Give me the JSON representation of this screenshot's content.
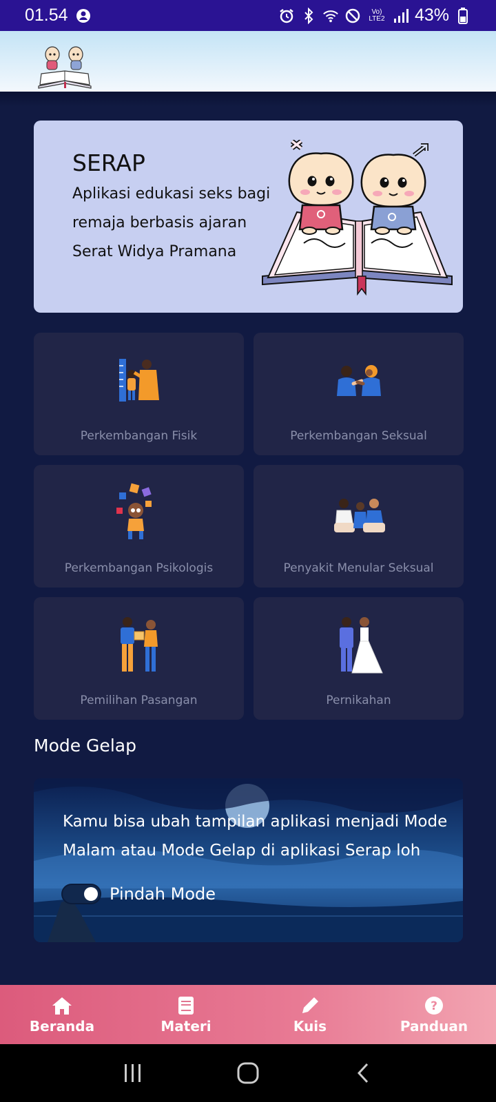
{
  "status": {
    "time": "01.54",
    "battery": "43%",
    "icons": [
      "profile-icon",
      "alarm-icon",
      "bluetooth-icon",
      "wifi-icon",
      "dnd-icon",
      "lte-icon",
      "signal-icon",
      "battery-icon"
    ],
    "lte_label": "Vo) LTE2"
  },
  "hero": {
    "title": "SERAP",
    "description": "Aplikasi edukasi seks bagi remaja berbasis ajaran Serat Widya Pramana"
  },
  "menu": [
    {
      "label": "Perkembangan Fisik",
      "icon": "height-measure-icon"
    },
    {
      "label": "Perkembangan Seksual",
      "icon": "couple-handshake-icon"
    },
    {
      "label": "Perkembangan Psikologis",
      "icon": "puzzle-thinking-icon"
    },
    {
      "label": "Penyakit Menular Seksual",
      "icon": "doctor-consult-icon"
    },
    {
      "label": "Pemilihan Pasangan",
      "icon": "gift-exchange-icon"
    },
    {
      "label": "Pernikahan",
      "icon": "wedding-couple-icon"
    }
  ],
  "dark_mode": {
    "section_title": "Mode Gelap",
    "text": "Kamu bisa ubah tampilan aplikasi menjadi Mode Malam atau Mode Gelap di aplikasi Serap loh",
    "toggle_label": "Pindah Mode",
    "toggle_on": true
  },
  "nav": [
    {
      "label": "Beranda",
      "icon": "home-icon"
    },
    {
      "label": "Materi",
      "icon": "book-icon"
    },
    {
      "label": "Kuis",
      "icon": "pencil-icon"
    },
    {
      "label": "Panduan",
      "icon": "help-icon"
    }
  ],
  "colors": {
    "background": "#111a42",
    "card": "#212547",
    "hero": "#c7cff1",
    "status_bar": "#2a1393",
    "nav_start": "#dc5b7c",
    "nav_end": "#f2a4b1"
  }
}
